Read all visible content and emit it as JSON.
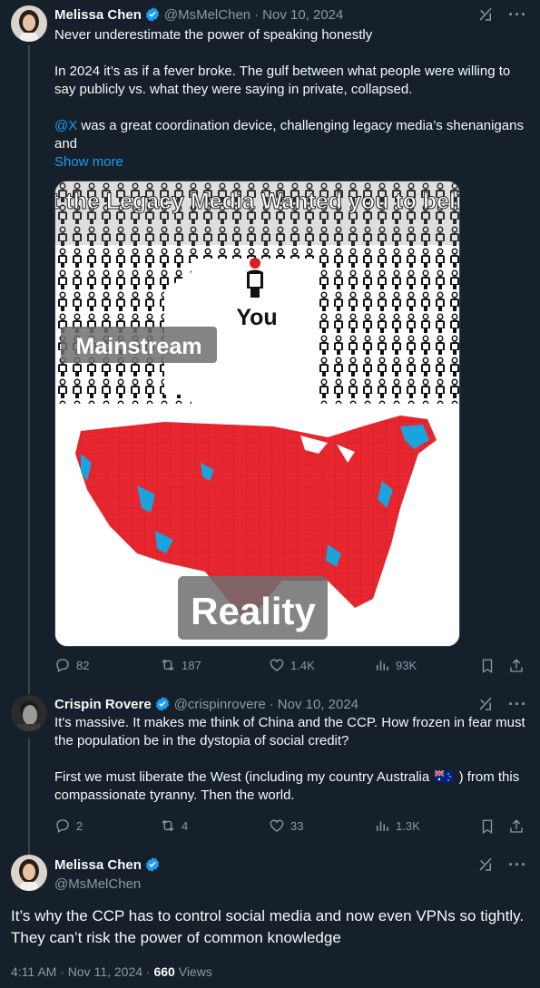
{
  "colors": {
    "background": "#15202b",
    "text": "#f7f9f9",
    "muted": "#8b98a5",
    "link": "#1d9bf0",
    "verified": "#1d9bf0"
  },
  "tweet1": {
    "name": "Melissa Chen",
    "handle": "@MsMelChen",
    "dot": "·",
    "date": "Nov 10, 2024",
    "text_line1": "Never underestimate the power of speaking honestly",
    "text_para2": "In 2024 it’s as if a fever broke. The gulf between what people were willing to say publicly vs. what they were saying in private, collapsed.",
    "mention": "@X",
    "text_para3": " was a great coordination device, challenging legacy media’s shenanigans and",
    "show_more": "Show more",
    "meme": {
      "top_caption": "what the Legacy Media Wanted you to believe.",
      "you_label": "You",
      "mainstream_label": "Mainstream",
      "reality_label": "Reality"
    },
    "replies": "82",
    "reposts": "187",
    "likes": "1.4K",
    "views": "93K"
  },
  "tweet2": {
    "name": "Crispin Rovere",
    "handle": "@crispinrovere",
    "dot": "·",
    "date": "Nov 10, 2024",
    "para1": "It's massive. It makes me think of China and the CCP. How frozen in fear must the population be in the dystopia of social credit?",
    "para2_a": "First we must liberate the West (including my country Australia",
    "para2_b": ") from this compassionate tyranny. Then the world.",
    "replies": "2",
    "reposts": "4",
    "likes": "33",
    "views": "1.3K"
  },
  "tweet3": {
    "name": "Melissa Chen",
    "handle": "@MsMelChen",
    "text": "It’s why the CCP has to control social media  and now even VPNs so tightly. They can’t risk the power of common knowledge",
    "time": "4:11 AM",
    "dot": "·",
    "date": "Nov 11, 2024",
    "dot2": "·",
    "views_count": "660",
    "views_label": "Views"
  }
}
